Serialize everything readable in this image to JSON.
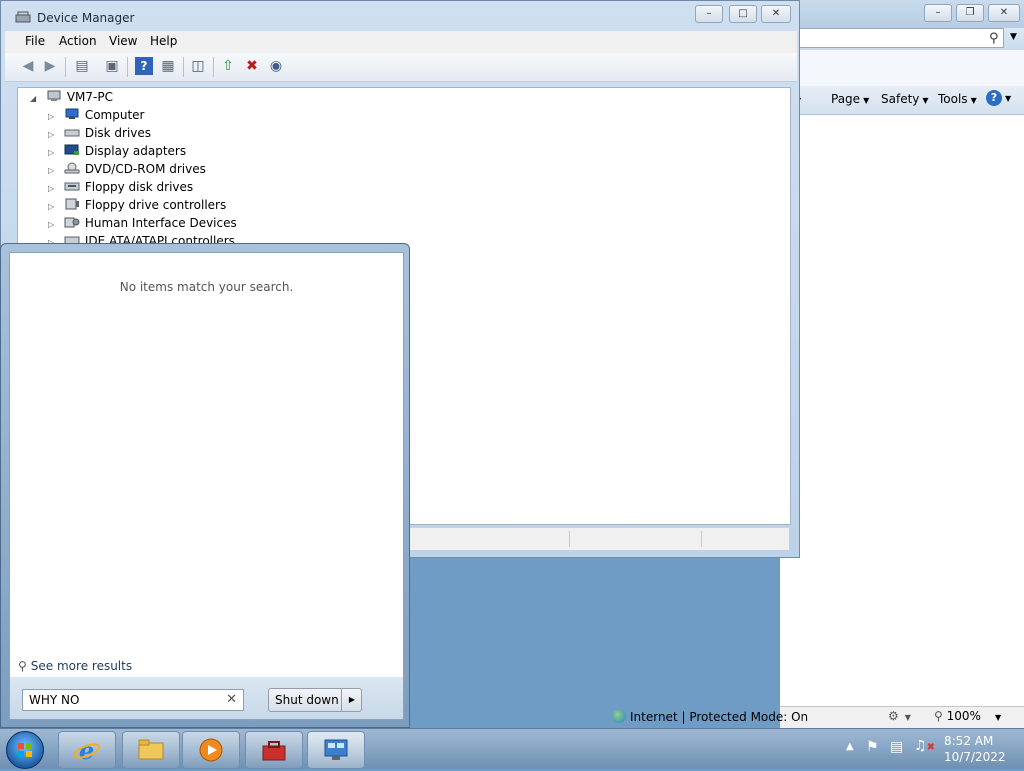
{
  "ie": {
    "command_bar": [
      {
        "label": "Page"
      },
      {
        "label": "Safety"
      },
      {
        "label": "Tools"
      }
    ],
    "status": {
      "zone": "Internet | Protected Mode: On",
      "zoom": "100%"
    }
  },
  "device_manager": {
    "title": "Device Manager",
    "menu": [
      "File",
      "Action",
      "View",
      "Help"
    ],
    "tree": {
      "root": "VM7-PC",
      "items": [
        "Computer",
        "Disk drives",
        "Display adapters",
        "DVD/CD-ROM drives",
        "Floppy disk drives",
        "Floppy drive controllers",
        "Human Interface Devices",
        "IDE ATA/ATAPI controllers"
      ]
    }
  },
  "start_menu": {
    "no_results": "No items match your search.",
    "see_more": "See more results",
    "search_value": "WHY NO",
    "shutdown_label": "Shut down"
  },
  "taskbar": {
    "apps": [
      "internet-explorer",
      "windows-explorer",
      "media-player",
      "toolbox",
      "control-panel"
    ],
    "clock": {
      "time": "8:52 AM",
      "date": "10/7/2022"
    }
  }
}
